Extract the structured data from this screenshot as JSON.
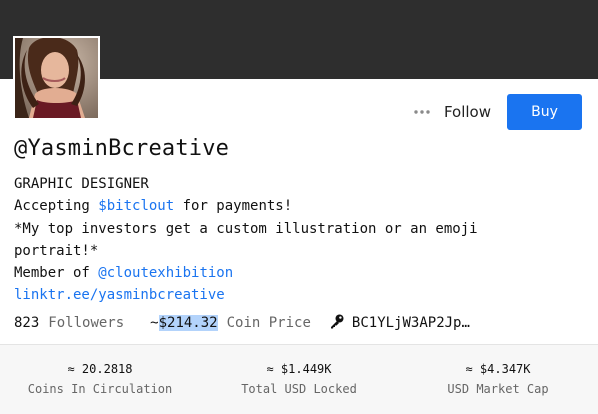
{
  "profile": {
    "username": "@YasminBcreative",
    "follow_label": "Follow",
    "buy_label": "Buy",
    "more_icon": "ellipsis-icon"
  },
  "bio": {
    "line1": "GRAPHIC DESIGNER",
    "line2_prefix": "Accepting ",
    "line2_link": "$bitclout",
    "line2_suffix": " for payments!",
    "line3": "*My top investors get a custom illustration or an emoji",
    "line4": "portrait!*",
    "line5_prefix": "Member of ",
    "line5_link": "@cloutexhibition",
    "line6_link": "linktr.ee/yasminbcreative"
  },
  "stats": {
    "followers_count": "823",
    "followers_label": "Followers",
    "coin_price_prefix": "~",
    "coin_price": "$214.32",
    "coin_price_label": "Coin Price",
    "public_key": "BC1YLjW3AP2Jp…",
    "key_icon": "key-icon"
  },
  "metrics": [
    {
      "value": "≈ 20.2818",
      "label": "Coins In Circulation"
    },
    {
      "value": "≈ $1.449K",
      "label": "Total USD Locked"
    },
    {
      "value": "≈ $4.347K",
      "label": "USD Market Cap"
    }
  ],
  "colors": {
    "banner": "#2e2e2e",
    "accent": "#1a74f0",
    "highlight": "#b3d3fb"
  }
}
